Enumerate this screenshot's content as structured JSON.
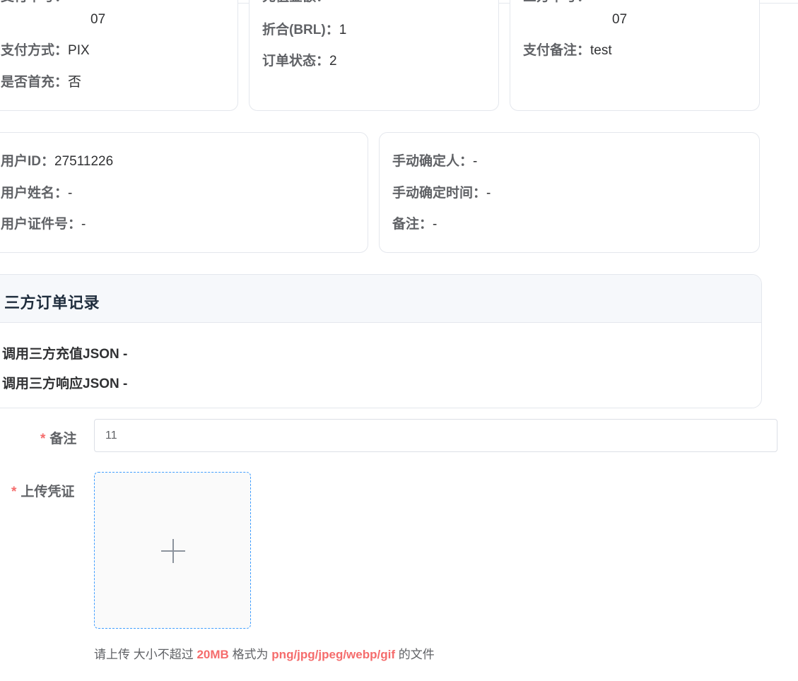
{
  "order_info": {
    "card_a": {
      "order_no_tail": "07",
      "pay_method": {
        "label": "支付方式：",
        "value": "PIX"
      },
      "first_recharge": {
        "label": "是否首充：",
        "value": "否"
      }
    },
    "card_b": {
      "converted": {
        "label": "折合(BRL)：",
        "value": "1"
      },
      "order_status": {
        "label": "订单状态：",
        "value": "2"
      }
    },
    "card_c": {
      "order_no_tail": "07",
      "pay_remark": {
        "label": "支付备注：",
        "value": "test"
      }
    }
  },
  "user_info": {
    "user_id": {
      "label": "用户ID：",
      "value": "27511226"
    },
    "user_name": {
      "label": "用户姓名：",
      "value": "-"
    },
    "user_cert_no": {
      "label": "用户证件号：",
      "value": "-"
    }
  },
  "manual_confirm": {
    "confirmer": {
      "label": "手动确定人：",
      "value": "-"
    },
    "confirm_time": {
      "label": "手动确定时间：",
      "value": "-"
    },
    "remark": {
      "label": "备注：",
      "value": "-"
    }
  },
  "third_party": {
    "title": "三方订单记录",
    "request_json": {
      "label": "调用三方充值JSON",
      "value": "-"
    },
    "response_json": {
      "label": "调用三方响应JSON",
      "value": "-"
    }
  },
  "form": {
    "required_mark": "*",
    "remark": {
      "label": "备注",
      "value": "11"
    },
    "upload": {
      "label": "上传凭证",
      "tip_prefix": "请上传 大小不超过",
      "size_limit": "20MB",
      "tip_middle": "格式为",
      "formats": "png/jpg/jpeg/webp/gif",
      "tip_suffix": "的文件"
    }
  },
  "icons": {
    "upload_add": "plus-icon"
  },
  "colors": {
    "required": "#f56c6c",
    "upload_border": "#409eff",
    "header_bg": "#f6f8fb"
  }
}
